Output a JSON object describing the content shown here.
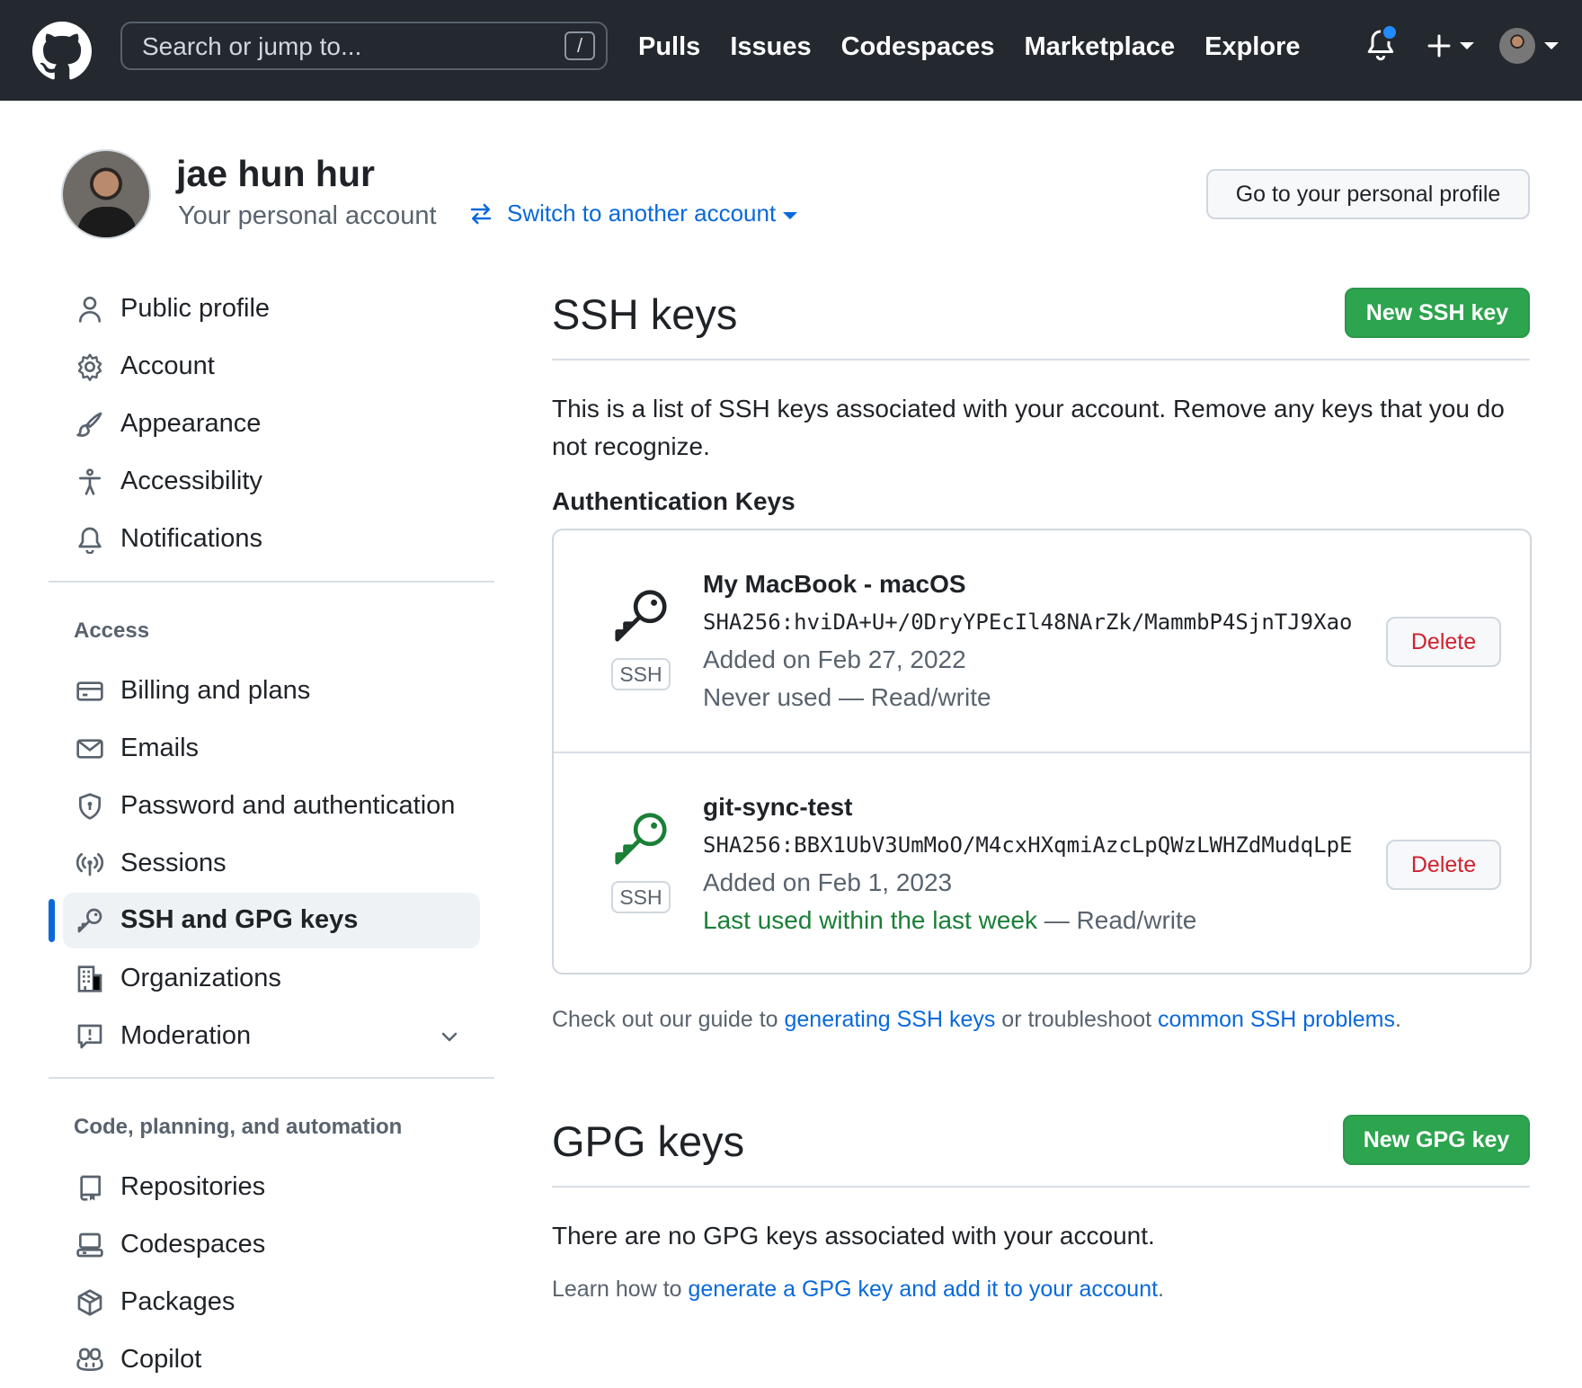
{
  "header": {
    "search_placeholder": "Search or jump to...",
    "search_shortcut": "/",
    "nav": [
      "Pulls",
      "Issues",
      "Codespaces",
      "Marketplace",
      "Explore"
    ],
    "notification_dot_color": "#218bff",
    "plus_icon": "plus-icon",
    "avatar_icon": "avatar"
  },
  "account": {
    "name": "jae hun hur",
    "subtitle": "Your personal account",
    "switch_label": "Switch to another account",
    "profile_button": "Go to your personal profile"
  },
  "sidebar": {
    "top_items": [
      {
        "label": "Public profile",
        "icon": "person-icon"
      },
      {
        "label": "Account",
        "icon": "gear-icon"
      },
      {
        "label": "Appearance",
        "icon": "paintbrush-icon"
      },
      {
        "label": "Accessibility",
        "icon": "accessibility-icon"
      },
      {
        "label": "Notifications",
        "icon": "bell-icon"
      }
    ],
    "access_heading": "Access",
    "access_items": [
      {
        "label": "Billing and plans",
        "icon": "credit-card-icon"
      },
      {
        "label": "Emails",
        "icon": "mail-icon"
      },
      {
        "label": "Password and authentication",
        "icon": "shield-lock-icon"
      },
      {
        "label": "Sessions",
        "icon": "broadcast-icon"
      },
      {
        "label": "SSH and GPG keys",
        "icon": "key-icon",
        "active": true
      },
      {
        "label": "Organizations",
        "icon": "organization-icon"
      },
      {
        "label": "Moderation",
        "icon": "report-icon"
      }
    ],
    "code_heading": "Code, planning, and automation",
    "code_items": [
      {
        "label": "Repositories",
        "icon": "repo-icon"
      },
      {
        "label": "Codespaces",
        "icon": "codespaces-icon"
      },
      {
        "label": "Packages",
        "icon": "package-icon"
      },
      {
        "label": "Copilot",
        "icon": "copilot-icon"
      }
    ]
  },
  "ssh": {
    "title": "SSH keys",
    "new_button": "New SSH key",
    "description": "This is a list of SSH keys associated with your account. Remove any keys that you do not recognize.",
    "auth_heading": "Authentication Keys",
    "keys": [
      {
        "name": "My MacBook - macOS",
        "fingerprint": "SHA256:hviDA+U+/0DryYPEcIl48NArZk/MammbP4SjnTJ9Xao",
        "added": "Added on Feb 27, 2022",
        "used_status": "Never used",
        "used_suffix": " — Read/write",
        "badge": "SSH",
        "delete_label": "Delete",
        "icon_color": "#1f2328"
      },
      {
        "name": "git-sync-test",
        "fingerprint": "SHA256:BBX1UbV3UmMoO/M4cxHXqmiAzcLpQWzLWHZdMudqLpE",
        "added": "Added on Feb 1, 2023",
        "used_status": "Last used within the last week",
        "used_suffix": " — Read/write",
        "badge": "SSH",
        "delete_label": "Delete",
        "icon_color": "#1a7f37"
      }
    ],
    "guide_prefix": "Check out our guide to ",
    "guide_link1": "generating SSH keys",
    "guide_middle": " or troubleshoot ",
    "guide_link2": "common SSH problems",
    "guide_suffix": "."
  },
  "gpg": {
    "title": "GPG keys",
    "new_button": "New GPG key",
    "empty_text": "There are no GPG keys associated with your account.",
    "learn_prefix": "Learn how to ",
    "learn_link": "generate a GPG key and add it to your account",
    "learn_suffix": "."
  },
  "colors": {
    "header_bg": "#24292f",
    "link": "#0969da",
    "primary_button": "#2da44e",
    "danger_text": "#cf222e",
    "success_text": "#1a7f37",
    "active_bar": "#0969da"
  }
}
